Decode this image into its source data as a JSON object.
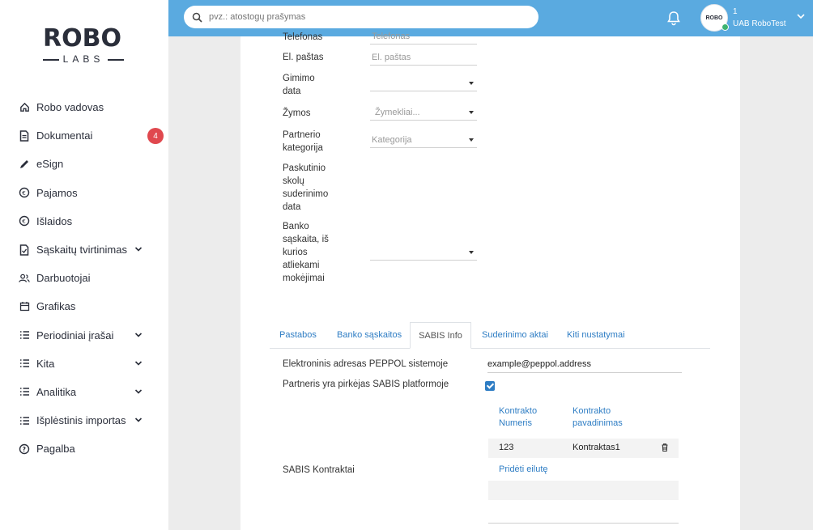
{
  "sidebar": {
    "logo_top": "ROBO",
    "logo_bottom": "LABS",
    "items": [
      {
        "label": "Robo vadovas",
        "icon": "home-icon"
      },
      {
        "label": "Dokumentai",
        "icon": "document-icon",
        "badge": "4"
      },
      {
        "label": "eSign",
        "icon": "pen-icon"
      },
      {
        "label": "Pajamos",
        "icon": "euro-in-icon"
      },
      {
        "label": "Išlaidos",
        "icon": "euro-out-icon"
      },
      {
        "label": "Sąskaitų tvirtinimas",
        "icon": "file-check-icon",
        "chevron": true
      },
      {
        "label": "Darbuotojai",
        "icon": "users-icon"
      },
      {
        "label": "Grafikas",
        "icon": "calendar-icon"
      },
      {
        "label": "Periodiniai įrašai",
        "icon": "list-icon",
        "chevron": true
      },
      {
        "label": "Kita",
        "icon": "list-icon",
        "chevron": true
      },
      {
        "label": "Analitika",
        "icon": "list-icon",
        "chevron": true
      },
      {
        "label": "Išplėstinis importas",
        "icon": "list-icon",
        "chevron": true
      },
      {
        "label": "Pagalba",
        "icon": "help-icon"
      }
    ]
  },
  "topbar": {
    "search_placeholder": "pvz.: atostogų prašymas",
    "avatar_text": "ROBO",
    "user_number": "1",
    "company": "UAB RoboTest"
  },
  "form": {
    "phone_label": "Telefonas",
    "phone_placeholder": "Telefonas",
    "email_label": "El. paštas",
    "email_placeholder": "El. paštas",
    "birth_label_1": "Gimimo",
    "birth_label_2": "data",
    "tags_label": "Žymos",
    "tags_placeholder": "Žymekliai...",
    "partner_cat_label_1": "Partnerio",
    "partner_cat_label_2": "kategorija",
    "partner_cat_placeholder": "Kategorija",
    "last_debt_label_1": "Paskutinio",
    "last_debt_label_2": "skolų",
    "last_debt_label_3": "suderinimo",
    "last_debt_label_4": "data",
    "bank_label_1": "Banko",
    "bank_label_2": "sąskaita, iš",
    "bank_label_3": "kurios",
    "bank_label_4": "atliekami",
    "bank_label_5": "mokėjimai"
  },
  "tabs": [
    "Pastabos",
    "Banko sąskaitos",
    "SABIS Info",
    "Suderinimo aktai",
    "Kiti nustatymai"
  ],
  "sabis": {
    "peppol_label": "Elektroninis adresas PEPPOL sistemoje",
    "peppol_value": "example@peppol.address",
    "buyer_label": "Partneris yra pirkėjas SABIS platformoje",
    "buyer_checked": true,
    "contracts_label": "SABIS Kontraktai",
    "col1_line1": "Kontrakto",
    "col1_line2": "Numeris",
    "col2_line1": "Kontrakto",
    "col2_line2": "pavadinimas",
    "row_number": "123",
    "row_name": "Kontraktas1",
    "add_row": "Pridėti eilutę"
  },
  "colors": {
    "topbar": "#5aaae0",
    "accent": "#2e7dc4",
    "badge": "#e0484e"
  }
}
